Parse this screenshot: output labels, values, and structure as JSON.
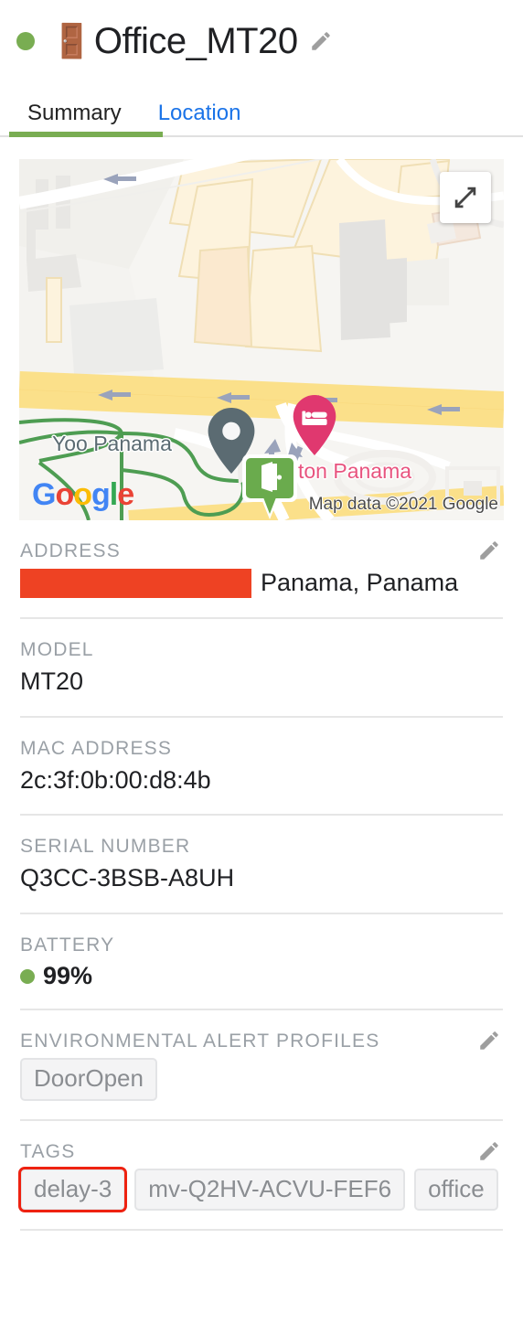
{
  "header": {
    "status_dot_color": "#79ad52",
    "device_icon": "door-emoji",
    "title": "Office_MT20",
    "edit_icon": "pencil-icon"
  },
  "tabs": {
    "items": [
      {
        "label": "Summary",
        "active": true
      },
      {
        "label": "Location",
        "active": false
      }
    ],
    "active_underline_color": "#79ad52",
    "inactive_link_color": "#1a73e8"
  },
  "map": {
    "expand_button_label": "expand-icon",
    "provider_logo": "Google",
    "attribution": "Map data ©2021 Google",
    "labels": [
      {
        "text": "Yoo Panama",
        "color": "#5b6b72"
      },
      {
        "text": "ton Panama",
        "color": "#e8547f"
      }
    ],
    "route_shield": "1",
    "markers": [
      {
        "name": "door-sensor-marker",
        "color": "#6aab4d",
        "icon": "door-icon"
      },
      {
        "name": "hotel-marker",
        "color": "#e0386f",
        "icon": "bed-icon"
      },
      {
        "name": "place-marker",
        "color": "#5b6b72",
        "icon": "circle-icon"
      },
      {
        "name": "bus-stop-marker",
        "color": "#2f66e0",
        "icon": "bus-icon"
      }
    ]
  },
  "details": {
    "address": {
      "label": "Address",
      "redacted": true,
      "redaction_color": "#ee4223",
      "value": "Panama, Panama",
      "editable": true
    },
    "model": {
      "label": "Model",
      "value": "MT20",
      "editable": false
    },
    "mac_address": {
      "label": "MAC Address",
      "value": "2c:3f:0b:00:d8:4b",
      "editable": false
    },
    "serial_number": {
      "label": "Serial Number",
      "value": "Q3CC-3BSB-A8UH",
      "editable": false
    },
    "battery": {
      "label": "Battery",
      "value": "99%",
      "dot_color": "#79ad52",
      "editable": false
    },
    "environmental_alert_profiles": {
      "label": "Environmental Alert Profiles",
      "editable": true,
      "chips": [
        {
          "label": "DoorOpen",
          "highlighted": false
        }
      ]
    },
    "tags": {
      "label": "Tags",
      "editable": true,
      "highlight_color": "#ee2211",
      "chips": [
        {
          "label": "delay-3",
          "highlighted": true
        },
        {
          "label": "mv-Q2HV-ACVU-FEF6",
          "highlighted": false
        },
        {
          "label": "office",
          "highlighted": false
        }
      ]
    }
  }
}
